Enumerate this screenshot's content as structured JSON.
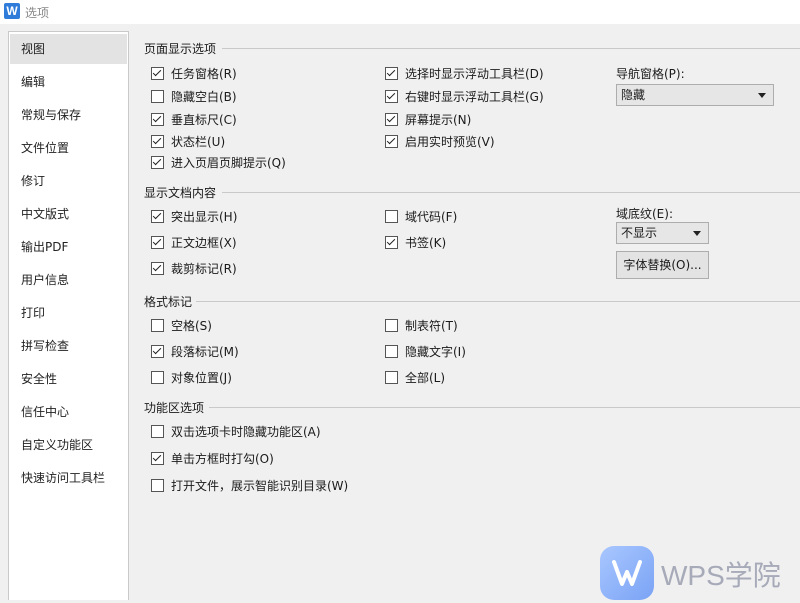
{
  "window": {
    "app_icon": "W",
    "title": "选项"
  },
  "sidebar": {
    "items": [
      {
        "label": "视图",
        "selected": true
      },
      {
        "label": "编辑"
      },
      {
        "label": "常规与保存"
      },
      {
        "label": "文件位置"
      },
      {
        "label": "修订"
      },
      {
        "label": "中文版式"
      },
      {
        "label": "输出PDF"
      },
      {
        "label": "用户信息"
      },
      {
        "label": "打印"
      },
      {
        "label": "拼写检查"
      },
      {
        "label": "安全性"
      },
      {
        "label": "信任中心"
      },
      {
        "label": "自定义功能区"
      },
      {
        "label": "快速访问工具栏"
      }
    ]
  },
  "sections": {
    "page_display": {
      "title": "页面显示选项",
      "options": [
        {
          "label": "任务窗格(R)",
          "checked": true
        },
        {
          "label": "隐藏空白(B)",
          "checked": false
        },
        {
          "label": "垂直标尺(C)",
          "checked": true
        },
        {
          "label": "状态栏(U)",
          "checked": true
        },
        {
          "label": "进入页眉页脚提示(Q)",
          "checked": true
        },
        {
          "label": "选择时显示浮动工具栏(D)",
          "checked": true
        },
        {
          "label": "右键时显示浮动工具栏(G)",
          "checked": true
        },
        {
          "label": "屏幕提示(N)",
          "checked": true
        },
        {
          "label": "启用实时预览(V)",
          "checked": true
        }
      ],
      "nav_pane": {
        "label": "导航窗格(P):",
        "value": "隐藏"
      }
    },
    "doc_content": {
      "title": "显示文档内容",
      "options": [
        {
          "label": "突出显示(H)",
          "checked": true
        },
        {
          "label": "正文边框(X)",
          "checked": true
        },
        {
          "label": "裁剪标记(R)",
          "checked": true
        },
        {
          "label": "域代码(F)",
          "checked": false
        },
        {
          "label": "书签(K)",
          "checked": true
        }
      ],
      "field_shading": {
        "label": "域底纹(E):",
        "value": "不显示"
      },
      "font_replace_button": "字体替换(O)..."
    },
    "format_marks": {
      "title": "格式标记",
      "options": [
        {
          "label": "空格(S)",
          "checked": false
        },
        {
          "label": "段落标记(M)",
          "checked": true
        },
        {
          "label": "对象位置(J)",
          "checked": false
        },
        {
          "label": "制表符(T)",
          "checked": false
        },
        {
          "label": "隐藏文字(I)",
          "checked": false
        },
        {
          "label": "全部(L)",
          "checked": false
        }
      ]
    },
    "ribbon": {
      "title": "功能区选项",
      "options": [
        {
          "label": "双击选项卡时隐藏功能区(A)",
          "checked": false
        },
        {
          "label": "单击方框时打勾(O)",
          "checked": true
        },
        {
          "label": "打开文件，展示智能识别目录(W)",
          "checked": false
        }
      ]
    }
  },
  "watermark": {
    "text": "WPS学院",
    "icon": "wps-logo-icon"
  }
}
